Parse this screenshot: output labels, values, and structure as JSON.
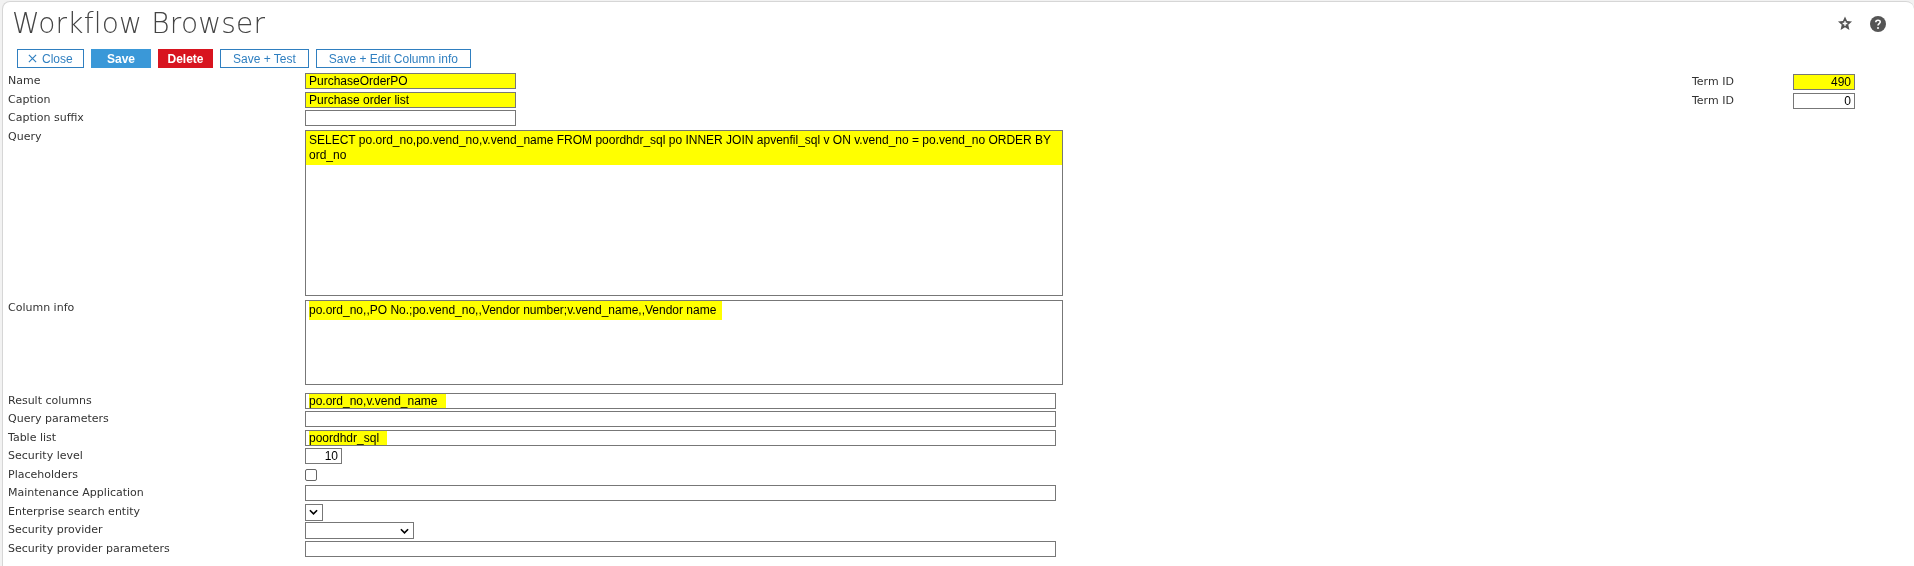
{
  "window": {
    "title": "Workflow Browser"
  },
  "toolbar": [
    {
      "label": "Close",
      "kind": "close"
    },
    {
      "label": "Save",
      "kind": "primary"
    },
    {
      "label": "Delete",
      "kind": "danger"
    },
    {
      "label": "Save + Test",
      "kind": "outline"
    },
    {
      "label": "Save + Edit Column info",
      "kind": "outline"
    }
  ],
  "fields": [
    {
      "label": "Name",
      "kind": "short-text",
      "value": "PurchaseOrderPO",
      "highlighted": true
    },
    {
      "label": "Caption",
      "kind": "short-text",
      "value": "Purchase order list",
      "highlighted": true
    },
    {
      "label": "Caption suffix",
      "kind": "short-text",
      "highlighted": false
    },
    {
      "label": "Query",
      "kind": "tall-textarea",
      "value": "SELECT po.ord_no,po.vend_no,v.vend_name FROM poordhdr_sql po INNER JOIN apvenfil_sql v ON v.vend_no = po.vend_no ORDER BY ord_no",
      "highlighted": true
    },
    {
      "label": "Column info",
      "kind": "textarea",
      "value": "po.ord_no,,PO No.;po.vend_no,,Vendor number;v.vend_name,,Vendor name",
      "highlighted": true
    },
    {
      "label": "Result columns",
      "kind": "text",
      "value": "po.ord_no,v.vend_name",
      "highlighted": true
    },
    {
      "label": "Query parameters",
      "kind": "text"
    },
    {
      "label": "Table list",
      "kind": "text",
      "value": "poordhdr_sql",
      "highlighted": true
    },
    {
      "label": "Security level",
      "kind": "number",
      "value": "10",
      "highlighted": false
    },
    {
      "label": "Placeholders",
      "kind": "checkbox",
      "checked": false
    },
    {
      "label": "Maintenance Application",
      "kind": "text"
    },
    {
      "label": "Enterprise search entity",
      "kind": "small-dropdown"
    },
    {
      "label": "Security provider",
      "kind": "dropdown"
    },
    {
      "label": "Security provider parameters",
      "kind": "text"
    }
  ],
  "side_fields": [
    {
      "label": "Term ID",
      "value": "490",
      "highlighted": true
    },
    {
      "label": "Term ID",
      "value": "0",
      "highlighted": false
    }
  ]
}
